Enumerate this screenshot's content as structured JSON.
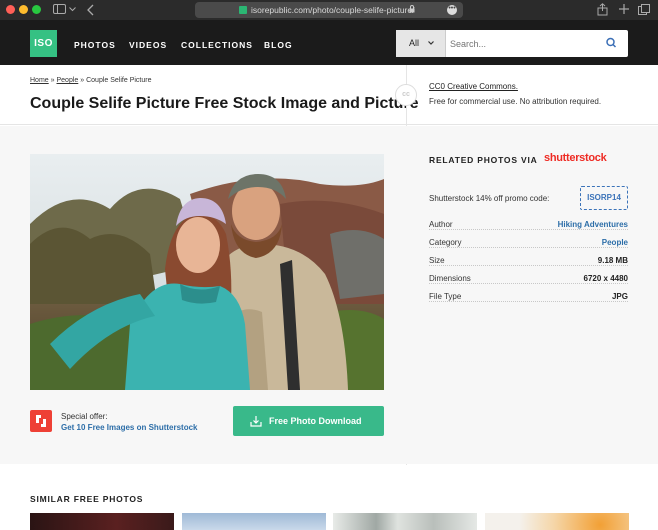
{
  "browser": {
    "url": "isorepublic.com/photo/couple-selife-picture/",
    "menu_glyph": "•••"
  },
  "header": {
    "logo": "ISO",
    "nav": [
      "PHOTOS",
      "VIDEOS",
      "COLLECTIONS",
      "BLOG"
    ],
    "search": {
      "category": "All",
      "placeholder": "Search..."
    }
  },
  "breadcrumb": {
    "items": [
      "Home",
      "People",
      "Couple Selife Picture"
    ],
    "separator": "»"
  },
  "page_title": "Couple Selife Picture Free Stock Image and Picture",
  "license": {
    "badge": "cc",
    "link": "CC0 Creative Commons.",
    "note": "Free for commercial use. No attribution required."
  },
  "offer": {
    "label": "Special offer:",
    "link": "Get 10 Free Images on Shutterstock"
  },
  "download_button": "Free Photo Download",
  "related": {
    "title": "RELATED PHOTOS VIA",
    "brand": "shutterstock",
    "promo_label": "Shutterstock 14% off promo code:",
    "promo_code": "ISORP14"
  },
  "info": [
    {
      "key": "Author",
      "value": "Hiking Adventures",
      "link": true
    },
    {
      "key": "Category",
      "value": "People",
      "link": true
    },
    {
      "key": "Size",
      "value": "9.18 MB",
      "link": false
    },
    {
      "key": "Dimensions",
      "value": "6720 x 4480",
      "link": false
    },
    {
      "key": "File Type",
      "value": "JPG",
      "link": false
    }
  ],
  "similar_title": "SIMILAR FREE PHOTOS",
  "colors": {
    "brand_green": "#35c183",
    "button_green": "#39b98a",
    "link_blue": "#2d6ea8",
    "shutterstock_red": "#ee2b24",
    "header_dark": "#1b1b1b"
  }
}
